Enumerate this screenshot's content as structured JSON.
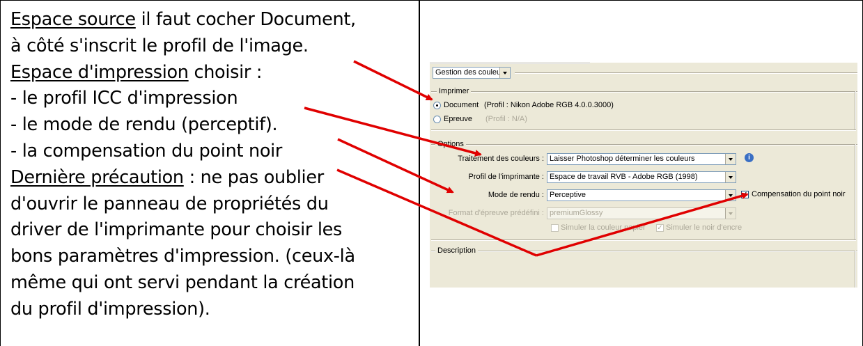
{
  "note": {
    "line1": {
      "underlined": "Espace source",
      "rest": " il faut cocher Document,"
    },
    "line2": "à côté s'inscrit le profil de l'image.",
    "line3": {
      "underlined": "Espace d'impression",
      "rest": " choisir :"
    },
    "line4": "- le profil ICC d'impression",
    "line5": "- le mode de rendu (perceptif).",
    "line6": "- la compensation du point noir",
    "line7": {
      "underlined": "Dernière précaution",
      "rest": " : ne pas oublier"
    },
    "line8": "d'ouvrir le panneau de propriétés du",
    "line9": "driver de l'imprimante pour choisir les",
    "line10": "bons paramètres d'impression. (ceux-là",
    "line11": "même qui ont servi pendant la création",
    "line12": "du profil d'impression)."
  },
  "dialog": {
    "section_select": "Gestion des couleurs",
    "print_group": {
      "legend": "Imprimer",
      "document_label": "Document",
      "document_profile": "(Profil : Nikon Adobe RGB 4.0.0.3000)",
      "epreuve_label": "Epreuve",
      "epreuve_profile": "(Profil : N/A)",
      "selected": "document"
    },
    "options_group": {
      "legend": "Options",
      "color_handling_label": "Traitement des couleurs :",
      "color_handling_value": "Laisser Photoshop déterminer les couleurs",
      "printer_profile_label": "Profil de l'imprimante :",
      "printer_profile_value": "Espace de travail RVB - Adobe RGB (1998)",
      "rendering_label": "Mode de rendu :",
      "rendering_value": "Perceptive",
      "black_point_label": "Compensation du point noir",
      "black_point_checked": true,
      "proof_setup_label": "Format d'épreuve prédéfini :",
      "proof_setup_value": "premiumGlossy",
      "simulate_paper_label": "Simuler la couleur papier",
      "simulate_ink_label": "Simuler le noir d'encre"
    },
    "description_group": {
      "legend": "Description"
    }
  },
  "colors": {
    "arrow": "#e00000",
    "dialog_bg": "#ece9d8"
  }
}
